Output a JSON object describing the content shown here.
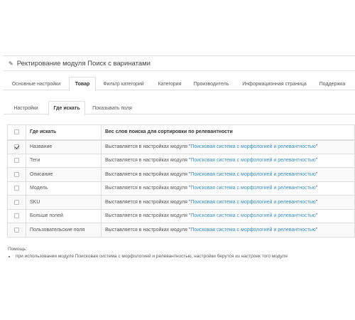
{
  "panel": {
    "title": "Ректирование модуля Поиск с варинатами"
  },
  "tabs": [
    {
      "label": "Основные настройки",
      "active": false
    },
    {
      "label": "Товар",
      "active": true
    },
    {
      "label": "Фильтр категорий",
      "active": false
    },
    {
      "label": "Категория",
      "active": false
    },
    {
      "label": "Производитель",
      "active": false
    },
    {
      "label": "Информационная страница",
      "active": false
    },
    {
      "label": "Поддержка",
      "active": false
    }
  ],
  "subtabs": [
    {
      "label": "Настройки",
      "active": false
    },
    {
      "label": "Где искать",
      "active": true
    },
    {
      "label": "Показывать поля",
      "active": false
    }
  ],
  "table": {
    "headers": [
      "Где искать",
      "Вес слов поиска для сортировки по релевантности"
    ],
    "rows": [
      {
        "name": "Название",
        "checked": true,
        "text": "Выставляется в настройках модуля \"",
        "link": "Поисковая система с морфологией и релевантностью",
        "suffix": "\""
      },
      {
        "name": "Теги",
        "checked": false,
        "text": "Выставляется в настройках модуля \"",
        "link": "Поисковая система с морфологией и релевантностью",
        "suffix": "\""
      },
      {
        "name": "Описание",
        "checked": false,
        "text": "Выставляется в настройках модуля \"",
        "link": "Поисковая система с морфологией и релевантностью",
        "suffix": "\""
      },
      {
        "name": "Модель",
        "checked": false,
        "text": "Выставляется в настройках модуля \"",
        "link": "Поисковая система с морфологией и релевантностью",
        "suffix": "\""
      },
      {
        "name": "SKU",
        "checked": false,
        "text": "Выставляется в настройках модуля \"",
        "link": "Поисковая система с морфологией и релевантностью",
        "suffix": "\""
      },
      {
        "name": "Больше полей",
        "checked": false,
        "text": "Выставляется в настройках модуля \"",
        "link": "Поисковая система с морфологией и релевантностью",
        "suffix": "\""
      },
      {
        "name": "Пользовательские поля",
        "checked": false,
        "text": "Выставляется в настройках модуля \"",
        "link": "Поисковая система с морфологией и релевантностью",
        "suffix": "\""
      }
    ]
  },
  "help": {
    "title": "Помощь:",
    "items": [
      "при использовании модуля Поисковая система с морфологией и релевантностью, настройки берутся из настроек того модуля"
    ]
  },
  "colors": {
    "link": "#3c8dbc",
    "border": "#dddddd",
    "stripe": "#f9f9f9"
  },
  "icons": {
    "heading": "pencil-icon"
  }
}
